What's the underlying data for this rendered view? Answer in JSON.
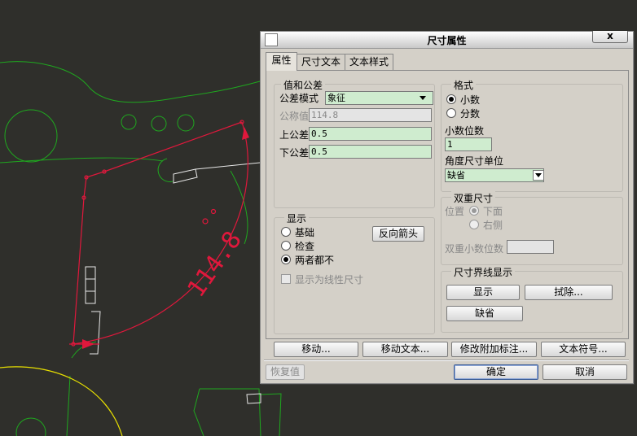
{
  "drawing": {
    "dimension_text": "114.8"
  },
  "dialog": {
    "title": "尺寸属性",
    "close_glyph": "x",
    "tabs": [
      {
        "label": "属性",
        "active": true
      },
      {
        "label": "尺寸文本",
        "active": false
      },
      {
        "label": "文本样式",
        "active": false
      }
    ],
    "values_tolerance": {
      "title": "值和公差",
      "mode_label": "公差模式",
      "mode_value": "象征",
      "nominal_label": "公称值",
      "nominal_value": "114.8",
      "upper_label": "上公差",
      "upper_value": "0.5",
      "lower_label": "下公差",
      "lower_value": "0.5"
    },
    "format": {
      "title": "格式",
      "decimal_label": "小数",
      "fraction_label": "分数",
      "selected": "decimal",
      "decimal_places_label": "小数位数",
      "decimal_places_value": "1",
      "angle_unit_label": "角度尺寸单位",
      "angle_unit_value": "缺省"
    },
    "dual": {
      "title": "双重尺寸",
      "position_label": "位置",
      "below_label": "下面",
      "right_label": "右侧",
      "dual_decimals_label": "双重小数位数",
      "dual_decimals_value": ""
    },
    "display": {
      "title": "显示",
      "basic_label": "基础",
      "inspect_label": "检查",
      "neither_label": "两者都不",
      "selected": "neither",
      "flip_button": "反向箭头",
      "linear_label": "显示为线性尺寸"
    },
    "witness": {
      "title": "尺寸界线显示",
      "show_button": "显示",
      "erase_button": "拭除...",
      "default_button": "缺省"
    },
    "actions": {
      "move": "移动...",
      "move_text": "移动文本...",
      "edit_attach": "修改附加标注...",
      "text_symbol": "文本符号..."
    },
    "footer": {
      "restore": "恢复值",
      "ok": "确定",
      "cancel": "取消"
    }
  },
  "colors": {
    "background": "#2f2f2b",
    "geometry": "#1fa81f",
    "dimension": "#e0183c",
    "highlight": "#e8e000",
    "field_bg": "#cfeccf"
  }
}
